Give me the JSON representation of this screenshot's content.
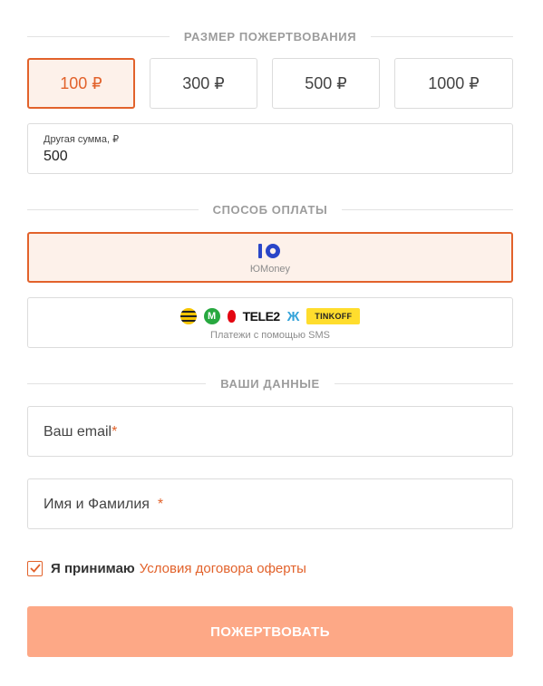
{
  "donation_size": {
    "title": "РАЗМЕР ПОЖЕРТВОВАНИЯ",
    "amounts": [
      {
        "label": "100 ₽",
        "selected": true
      },
      {
        "label": "300 ₽",
        "selected": false
      },
      {
        "label": "500 ₽",
        "selected": false
      },
      {
        "label": "1000 ₽",
        "selected": false
      }
    ],
    "other_sum_label": "Другая сумма, ₽",
    "other_sum_value": "500"
  },
  "payment_method": {
    "title": "СПОСОБ ОПЛАТЫ",
    "options": [
      {
        "caption": "ЮMoney",
        "selected": true
      },
      {
        "caption": "Платежи с помощью SMS",
        "selected": false
      }
    ],
    "sms_brands": {
      "megafon": "М",
      "tele2": "TELE2",
      "yota": "Ж",
      "tinkoff": "TINKOFF"
    }
  },
  "your_data": {
    "title": "ВАШИ ДАННЫЕ",
    "email_placeholder": "Ваш email",
    "name_placeholder": "Имя и Фамилия",
    "required_mark": "*"
  },
  "agreement": {
    "checked": true,
    "text": "Я принимаю",
    "link": "Условия договора оферты"
  },
  "submit_label": "ПОЖЕРТВОВАТЬ",
  "colors": {
    "accent": "#e2622b",
    "accent_bg": "#fdf1ea",
    "submit_bg": "#fda886",
    "border": "#dcdcdc",
    "section_title": "#9c9c9c"
  }
}
